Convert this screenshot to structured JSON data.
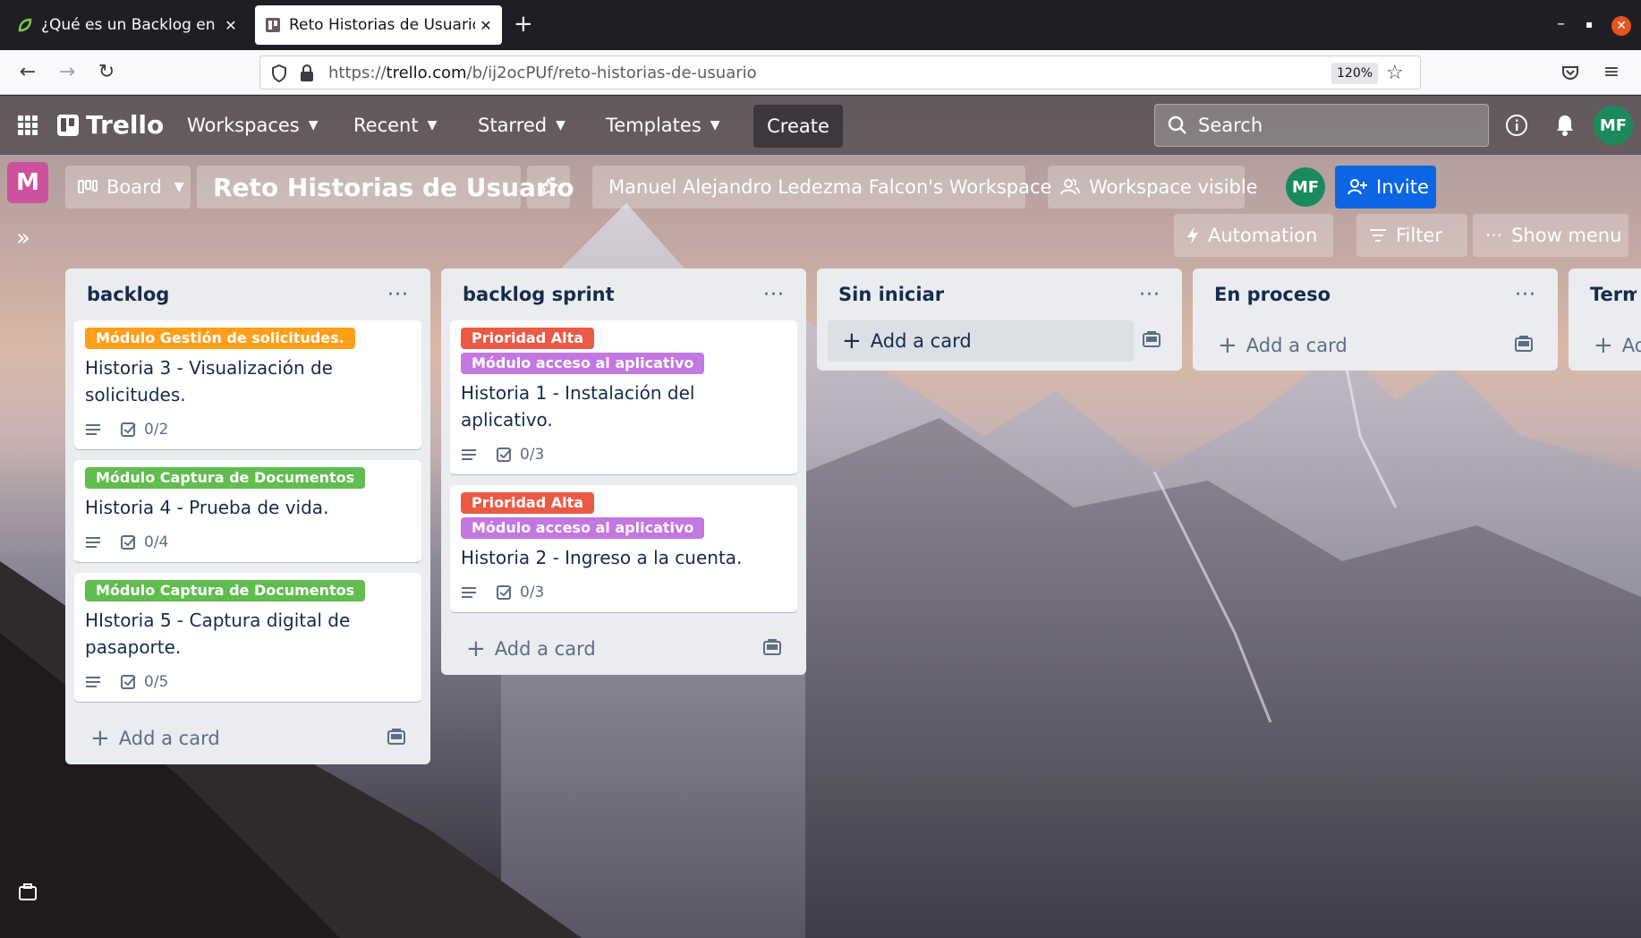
{
  "browser": {
    "tabs": [
      {
        "title": "¿Qué es un Backlog en Sc",
        "close": "✕"
      },
      {
        "title": "Reto Historias de Usuario",
        "close": "✕"
      }
    ],
    "new_tab": "+",
    "url_prefix": "https://",
    "url_domain": "trello.com",
    "url_path": "/b/ij2ocPUf/reto-historias-de-usuario",
    "zoom": "120%"
  },
  "header": {
    "logo": "Trello",
    "nav": [
      "Workspaces",
      "Recent",
      "Starred",
      "Templates"
    ],
    "create": "Create",
    "search_placeholder": "Search",
    "avatar": "MF"
  },
  "board_header": {
    "workspace_initial": "M",
    "view": "Board",
    "title": "Reto Historias de Usuario",
    "workspace": "Manuel Alejandro Ledezma Falcon's Workspace",
    "visibility": "Workspace visible",
    "member": "MF",
    "invite": "Invite",
    "automation": "Automation",
    "filter": "Filter",
    "show_menu": "Show menu"
  },
  "lists": [
    {
      "title": "backlog",
      "add_card": "Add a card",
      "cards": [
        {
          "labels": [
            {
              "text": "Módulo Gestión de solicitudes.",
              "color": "#ff9f1a"
            }
          ],
          "title": "Historia 3 - Visualización de solicitudes.",
          "checklist": "0/2"
        },
        {
          "labels": [
            {
              "text": "Módulo Captura de Documentos",
              "color": "#61bd4f"
            }
          ],
          "title": "Historia 4 - Prueba de vida.",
          "checklist": "0/4"
        },
        {
          "labels": [
            {
              "text": "Módulo Captura de Documentos",
              "color": "#61bd4f"
            }
          ],
          "title": "HIstoria 5 - Captura digital de pasaporte.",
          "checklist": "0/5"
        }
      ]
    },
    {
      "title": "backlog sprint",
      "add_card": "Add a card",
      "cards": [
        {
          "labels": [
            {
              "text": "Prioridad Alta",
              "color": "#eb5a46"
            },
            {
              "text": "Módulo acceso al aplicativo",
              "color": "#c377e0"
            }
          ],
          "title": "Historia 1 - Instalación del aplicativo.",
          "checklist": "0/3"
        },
        {
          "labels": [
            {
              "text": "Prioridad Alta",
              "color": "#eb5a46"
            },
            {
              "text": "Módulo acceso al aplicativo",
              "color": "#c377e0"
            }
          ],
          "title": "Historia 2 - Ingreso a la cuenta.",
          "checklist": "0/3"
        }
      ]
    },
    {
      "title": "Sin iniciar",
      "add_card": "Add a card",
      "cards": []
    },
    {
      "title": "En proceso",
      "add_card": "Add a card",
      "cards": []
    },
    {
      "title": "Termi",
      "add_card": "Ad",
      "cards": []
    }
  ],
  "colors": {
    "invite": "#0c66e4",
    "workspace_badge": "#cd519d",
    "avatar": "#1b8a5a",
    "list_bg": "#ebecf0"
  }
}
